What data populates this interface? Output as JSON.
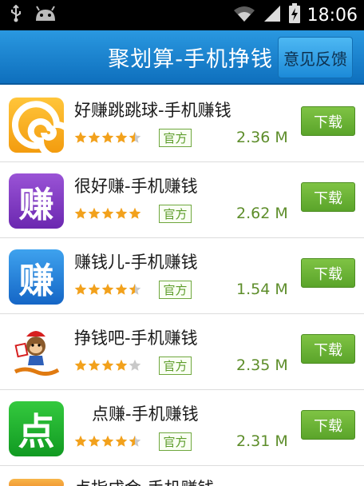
{
  "status_bar": {
    "icons": [
      "usb-icon",
      "android-icon",
      "wifi-icon",
      "signal-icon",
      "battery-charging-icon"
    ],
    "time": "18:06"
  },
  "header": {
    "title": "聚划算-手机挣钱",
    "feedback_label": "意见反馈"
  },
  "apps": [
    {
      "name": "好赚跳跳球-手机赚钱",
      "rating_stars": 4.5,
      "badge": "官方",
      "size": "2.36 M",
      "download_label": "下载",
      "icon": "spiral-icon"
    },
    {
      "name": "很好赚-手机赚钱",
      "rating_stars": 5,
      "badge": "官方",
      "size": "2.62 M",
      "download_label": "下载",
      "icon": "zhuan-purple-icon",
      "icon_text": "赚"
    },
    {
      "name": "赚钱儿-手机赚钱",
      "rating_stars": 4.5,
      "badge": "官方",
      "size": "1.54 M",
      "download_label": "下载",
      "icon": "zhuan-blue-icon",
      "icon_text": "赚"
    },
    {
      "name": "挣钱吧-手机赚钱",
      "rating_stars": 4,
      "badge": "官方",
      "size": "2.35 M",
      "download_label": "下载",
      "icon": "monkey-icon"
    },
    {
      "name": "点赚-手机赚钱",
      "rating_stars": 4.5,
      "badge": "官方",
      "size": "2.31 M",
      "download_label": "下载",
      "icon": "dian-green-icon",
      "icon_text": "点"
    }
  ],
  "partial_item": {
    "name": "点指成金-手机赚钱"
  },
  "colors": {
    "title_bar": "#1a85d4",
    "download": "#67b135",
    "size_text": "#5d8d2a"
  }
}
